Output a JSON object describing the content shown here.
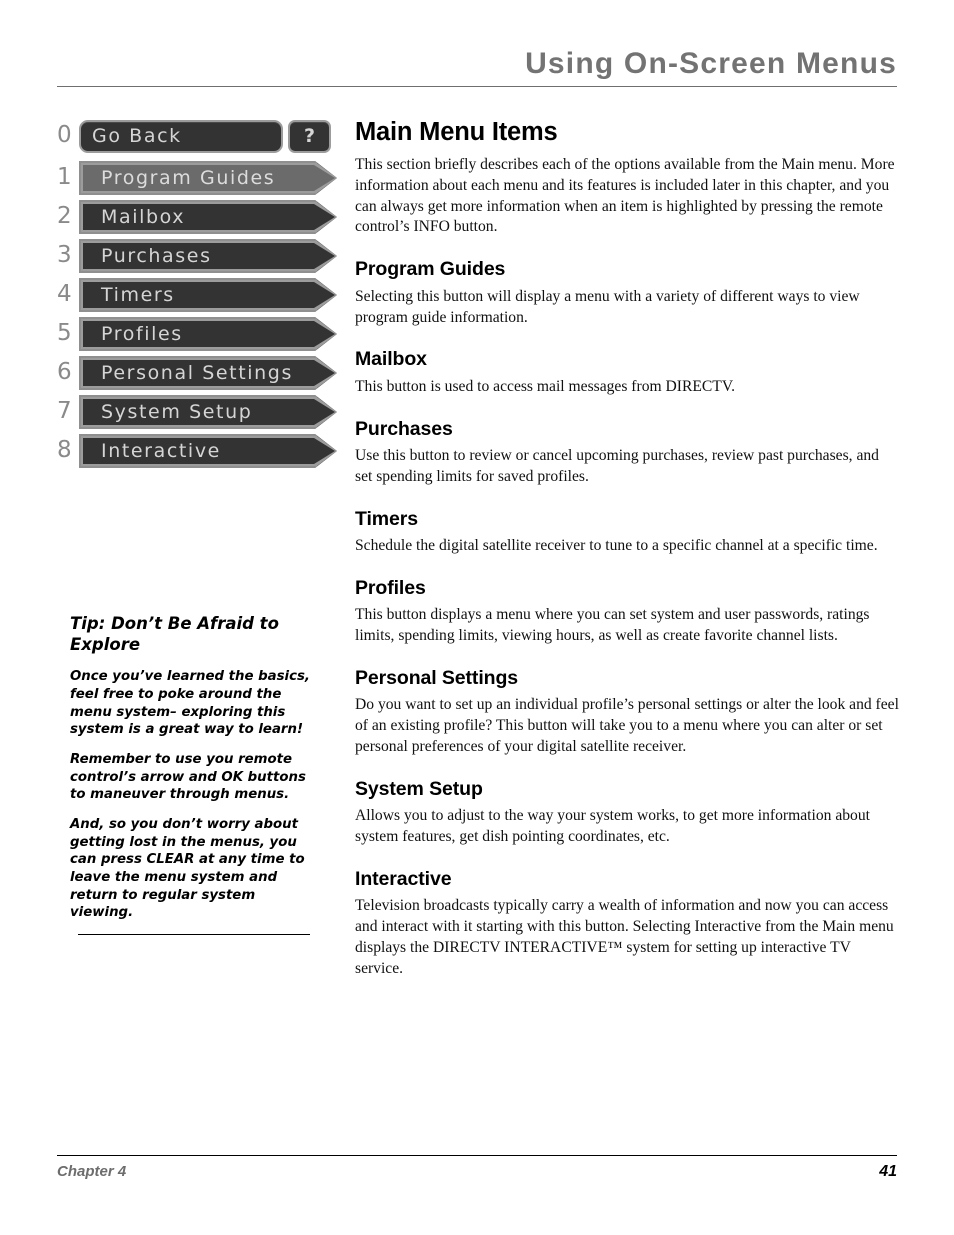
{
  "header": {
    "title": "Using On-Screen Menus"
  },
  "menu_graphic": {
    "go_back": {
      "number": "0",
      "label": "Go Back",
      "help_glyph": "?"
    },
    "items": [
      {
        "number": "1",
        "label": "Program Guides",
        "highlighted": true
      },
      {
        "number": "2",
        "label": "Mailbox",
        "highlighted": false
      },
      {
        "number": "3",
        "label": "Purchases",
        "highlighted": false
      },
      {
        "number": "4",
        "label": "Timers",
        "highlighted": false
      },
      {
        "number": "5",
        "label": "Profiles",
        "highlighted": false
      },
      {
        "number": "6",
        "label": "Personal Settings",
        "highlighted": false
      },
      {
        "number": "7",
        "label": "System Setup",
        "highlighted": false
      },
      {
        "number": "8",
        "label": "Interactive",
        "highlighted": false
      }
    ]
  },
  "tip": {
    "heading": "Tip: Don’t Be Afraid to Explore",
    "paragraphs": [
      "Once you’ve learned the basics, feel free to poke around the menu system– exploring this system is a great way to learn!",
      "Remember to use you remote control’s arrow and OK buttons to maneuver through menus.",
      "And, so you don’t worry about getting lost in the menus, you can press CLEAR at any time to leave the menu system and return to regular system viewing."
    ]
  },
  "main": {
    "title": "Main Menu Items",
    "intro": "This section briefly describes each of the options available from the Main menu. More information about each menu and its features is included later in this chapter, and you can always get more information when an item is highlighted by pressing the remote control’s INFO button.",
    "sections": [
      {
        "heading": "Program Guides",
        "body": "Selecting this button will display a menu with a variety of different ways to view program guide information."
      },
      {
        "heading": "Mailbox",
        "body": "This button is used to access mail messages from DIRECTV."
      },
      {
        "heading": "Purchases",
        "body": "Use this button to review or cancel upcoming purchases, review past purchases, and set spending limits for saved profiles."
      },
      {
        "heading": "Timers",
        "body": "Schedule the digital satellite receiver to tune to a specific channel at a specific time."
      },
      {
        "heading": "Profiles",
        "body": "This button displays a menu where you can set system and user passwords, ratings limits, spending limits, viewing hours, as well as create favorite channel lists."
      },
      {
        "heading": "Personal Settings",
        "body": "Do you want to set up an individual profile’s personal settings or alter the look and feel of an existing profile? This button will take you to a menu where you can alter or set personal preferences of your digital satellite receiver."
      },
      {
        "heading": "System Setup",
        "body": "Allows you to adjust to the way your system works, to get more information about system features, get dish pointing coordinates, etc."
      },
      {
        "heading": "Interactive",
        "body": "Television broadcasts typically carry a wealth of information and now you can access and interact with it starting with this button. Selecting Interactive from the Main menu displays the DIRECTV INTERACTIVE™ system for setting up interactive TV service."
      }
    ]
  },
  "footer": {
    "chapter": "Chapter 4",
    "page": "41"
  },
  "colors": {
    "header_gray": "#737373",
    "menu_dark": "#333333",
    "menu_border": "#9c9c9c",
    "menu_highlight": "#6b6b6b",
    "menu_text": "#d5d5d5",
    "number_gray": "#8a8a8a",
    "footer_gray": "#6d6d6d"
  }
}
